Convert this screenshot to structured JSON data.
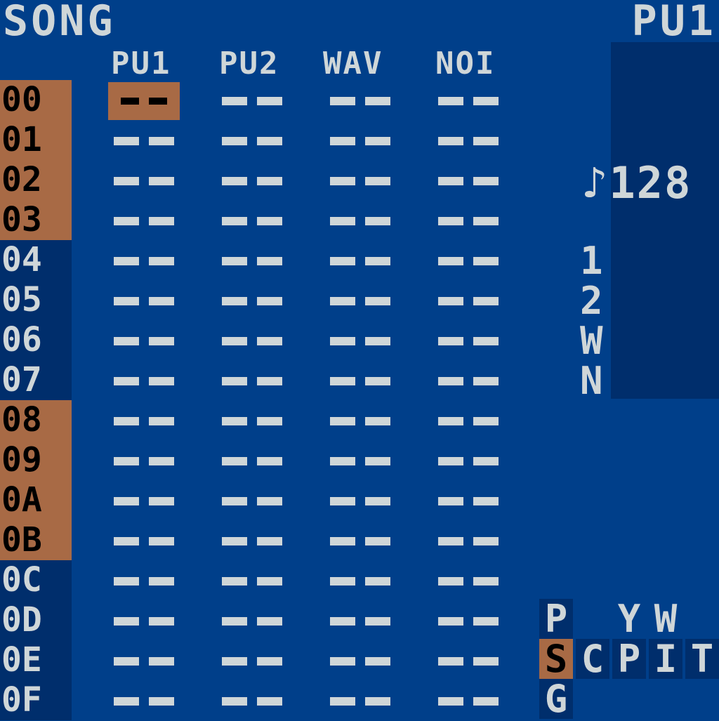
{
  "title": "SONG",
  "channel_label": "PU1",
  "columns": [
    "PU1",
    "PU2",
    "WAV",
    "NOI"
  ],
  "empty_cell": "--",
  "rows": [
    {
      "num": "00",
      "highlight": true
    },
    {
      "num": "01",
      "highlight": true
    },
    {
      "num": "02",
      "highlight": true
    },
    {
      "num": "03",
      "highlight": true
    },
    {
      "num": "04",
      "highlight": false
    },
    {
      "num": "05",
      "highlight": false
    },
    {
      "num": "06",
      "highlight": false
    },
    {
      "num": "07",
      "highlight": false
    },
    {
      "num": "08",
      "highlight": true
    },
    {
      "num": "09",
      "highlight": true
    },
    {
      "num": "0A",
      "highlight": true
    },
    {
      "num": "0B",
      "highlight": true
    },
    {
      "num": "0C",
      "highlight": false
    },
    {
      "num": "0D",
      "highlight": false
    },
    {
      "num": "0E",
      "highlight": false
    },
    {
      "num": "0F",
      "highlight": false
    }
  ],
  "cursor": {
    "row": 0,
    "column": "PU1"
  },
  "tempo": "♪128",
  "mute_channels": [
    "1",
    "2",
    "W",
    "N"
  ],
  "screen_map": {
    "top_row": [
      "P",
      "",
      "Y",
      "W"
    ],
    "middle_row": [
      "S",
      "C",
      "P",
      "I",
      "T"
    ],
    "bottom_row": [
      "G"
    ],
    "current": "S"
  },
  "colors": {
    "background": "#003f8a",
    "panel": "#002e6c",
    "highlight": "#a86a45",
    "text": "#cfd6d8"
  }
}
